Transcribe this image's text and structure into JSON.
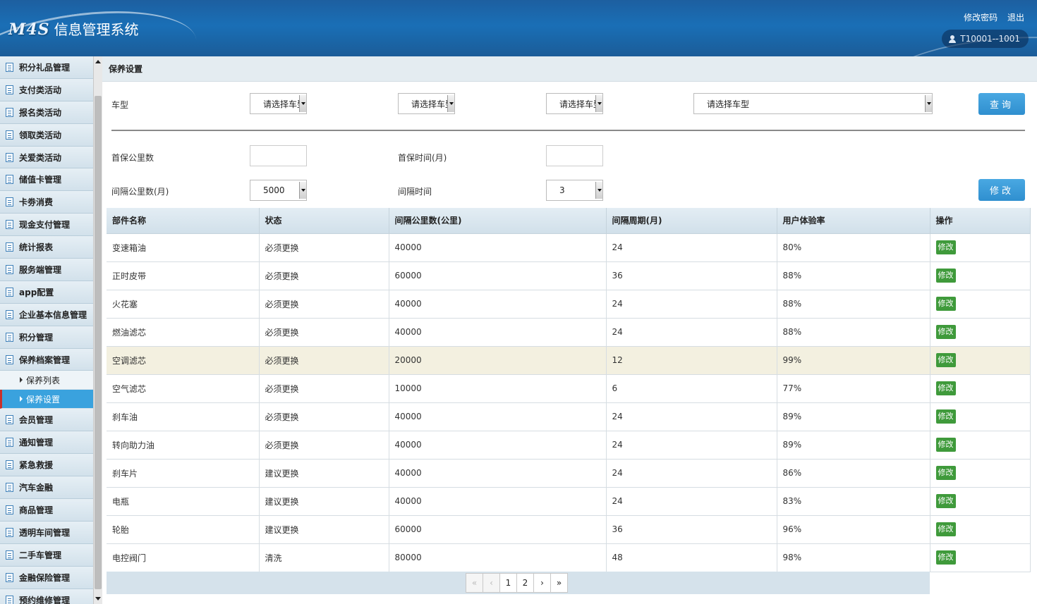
{
  "header": {
    "brand": "M4S",
    "system_name": "信息管理系统",
    "change_password": "修改密码",
    "logout": "退出",
    "user": "T10001--1001"
  },
  "sidebar": {
    "items": [
      {
        "label": "积分礼品管理"
      },
      {
        "label": "支付类活动"
      },
      {
        "label": "报名类活动"
      },
      {
        "label": "领取类活动"
      },
      {
        "label": "关爱类活动"
      },
      {
        "label": "储值卡管理"
      },
      {
        "label": "卡劵消费"
      },
      {
        "label": "现金支付管理"
      },
      {
        "label": "统计报表"
      },
      {
        "label": "服务端管理"
      },
      {
        "label": "app配置"
      },
      {
        "label": "企业基本信息管理"
      },
      {
        "label": "积分管理"
      },
      {
        "label": "保养档案管理"
      }
    ],
    "sub_items": [
      {
        "label": "保养列表"
      },
      {
        "label": "保养设置"
      }
    ],
    "items_after": [
      {
        "label": "会员管理"
      },
      {
        "label": "通知管理"
      },
      {
        "label": "紧急救援"
      },
      {
        "label": "汽车金融"
      },
      {
        "label": "商品管理"
      },
      {
        "label": "透明车间管理"
      },
      {
        "label": "二手车管理"
      },
      {
        "label": "金融保险管理"
      },
      {
        "label": "预约维修管理"
      }
    ]
  },
  "breadcrumb": "保养设置",
  "filters": {
    "car_type_label": "车型",
    "select1": "请选择车型",
    "select2": "请选择车型",
    "select3": "请选择车型",
    "select4": "请选择车型",
    "query_button": "查询"
  },
  "settings": {
    "first_mileage_label": "首保公里数",
    "first_mileage_value": "",
    "first_time_label": "首保时间(月)",
    "first_time_value": "",
    "interval_mileage_label": "间隔公里数(月)",
    "interval_mileage_value": "5000",
    "interval_time_label": "间隔时间",
    "interval_time_value": "3",
    "edit_button": "修改"
  },
  "table": {
    "columns": [
      "部件名称",
      "状态",
      "间隔公里数(公里)",
      "间隔周期(月)",
      "用户体验率",
      "操作"
    ],
    "action_label": "修改",
    "rows": [
      {
        "part": "变速箱油",
        "status": "必须更换",
        "km": "40000",
        "months": "24",
        "rate": "80%"
      },
      {
        "part": "正时皮带",
        "status": "必须更换",
        "km": "60000",
        "months": "36",
        "rate": "88%"
      },
      {
        "part": "火花塞",
        "status": "必须更换",
        "km": "40000",
        "months": "24",
        "rate": "88%"
      },
      {
        "part": "燃油滤芯",
        "status": "必须更换",
        "km": "40000",
        "months": "24",
        "rate": "88%"
      },
      {
        "part": "空调滤芯",
        "status": "必须更换",
        "km": "20000",
        "months": "12",
        "rate": "99%"
      },
      {
        "part": "空气滤芯",
        "status": "必须更换",
        "km": "10000",
        "months": "6",
        "rate": "77%"
      },
      {
        "part": "刹车油",
        "status": "必须更换",
        "km": "40000",
        "months": "24",
        "rate": "89%"
      },
      {
        "part": "转向助力油",
        "status": "必须更换",
        "km": "40000",
        "months": "24",
        "rate": "89%"
      },
      {
        "part": "刹车片",
        "status": "建议更换",
        "km": "40000",
        "months": "24",
        "rate": "86%"
      },
      {
        "part": "电瓶",
        "status": "建议更换",
        "km": "40000",
        "months": "24",
        "rate": "83%"
      },
      {
        "part": "轮胎",
        "status": "建议更换",
        "km": "60000",
        "months": "36",
        "rate": "96%"
      },
      {
        "part": "电控阀门",
        "status": "清洗",
        "km": "80000",
        "months": "48",
        "rate": "98%"
      }
    ]
  },
  "pager": {
    "first": "«",
    "prev": "‹",
    "pages": [
      "1",
      "2"
    ],
    "next": "›",
    "last": "»"
  }
}
